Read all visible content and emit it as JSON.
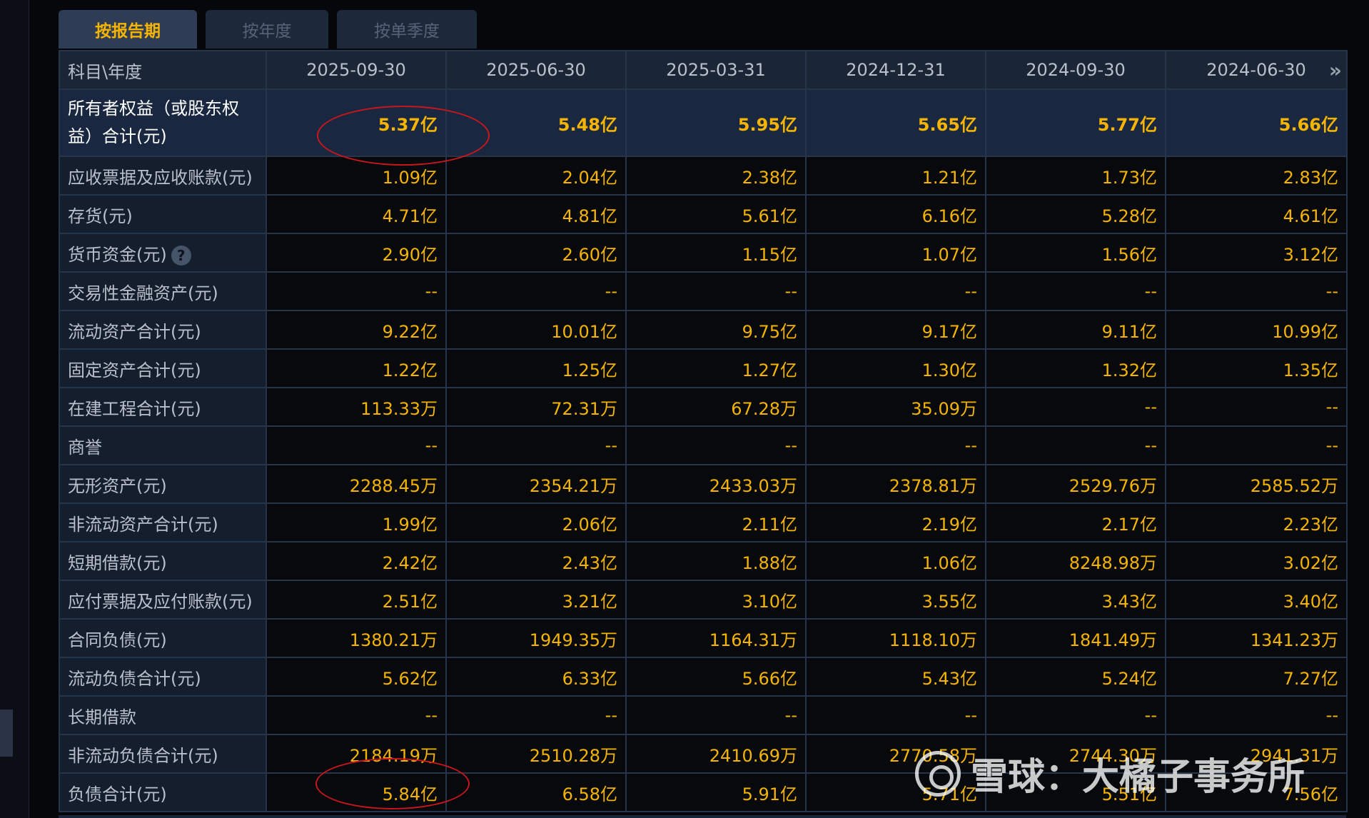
{
  "tabs": [
    {
      "label": "按报告期",
      "active": true
    },
    {
      "label": "按年度",
      "active": false
    },
    {
      "label": "按单季度",
      "active": false
    }
  ],
  "header": {
    "label": "科目\\年度",
    "periods": [
      "2025-09-30",
      "2025-06-30",
      "2025-03-31",
      "2024-12-31",
      "2024-09-30",
      "2024-06-30"
    ],
    "more_icon": "double-chevron-right-icon"
  },
  "rows": [
    {
      "label": "所有者权益（或股东权益）合计(元)",
      "values": [
        "5.37亿",
        "5.48亿",
        "5.95亿",
        "5.65亿",
        "5.77亿",
        "5.66亿"
      ]
    },
    {
      "label": "应收票据及应收账款(元)",
      "values": [
        "1.09亿",
        "2.04亿",
        "2.38亿",
        "1.21亿",
        "1.73亿",
        "2.83亿"
      ]
    },
    {
      "label": "存货(元)",
      "values": [
        "4.71亿",
        "4.81亿",
        "5.61亿",
        "6.16亿",
        "5.28亿",
        "4.61亿"
      ]
    },
    {
      "label": "货币资金(元)",
      "values": [
        "2.90亿",
        "2.60亿",
        "1.15亿",
        "1.07亿",
        "1.56亿",
        "3.12亿"
      ]
    },
    {
      "label": "交易性金融资产(元)",
      "values": [
        "--",
        "--",
        "--",
        "--",
        "--",
        "--"
      ]
    },
    {
      "label": "流动资产合计(元)",
      "values": [
        "9.22亿",
        "10.01亿",
        "9.75亿",
        "9.17亿",
        "9.11亿",
        "10.99亿"
      ]
    },
    {
      "label": "固定资产合计(元)",
      "values": [
        "1.22亿",
        "1.25亿",
        "1.27亿",
        "1.30亿",
        "1.32亿",
        "1.35亿"
      ]
    },
    {
      "label": "在建工程合计(元)",
      "values": [
        "113.33万",
        "72.31万",
        "67.28万",
        "35.09万",
        "--",
        "--"
      ]
    },
    {
      "label": "商誉",
      "values": [
        "--",
        "--",
        "--",
        "--",
        "--",
        "--"
      ]
    },
    {
      "label": "无形资产(元)",
      "values": [
        "2288.45万",
        "2354.21万",
        "2433.03万",
        "2378.81万",
        "2529.76万",
        "2585.52万"
      ]
    },
    {
      "label": "非流动资产合计(元)",
      "values": [
        "1.99亿",
        "2.06亿",
        "2.11亿",
        "2.19亿",
        "2.17亿",
        "2.23亿"
      ]
    },
    {
      "label": "短期借款(元)",
      "values": [
        "2.42亿",
        "2.43亿",
        "1.88亿",
        "1.06亿",
        "8248.98万",
        "3.02亿"
      ]
    },
    {
      "label": "应付票据及应付账款(元)",
      "values": [
        "2.51亿",
        "3.21亿",
        "3.10亿",
        "3.55亿",
        "3.43亿",
        "3.40亿"
      ]
    },
    {
      "label": "合同负债(元)",
      "values": [
        "1380.21万",
        "1949.35万",
        "1164.31万",
        "1118.10万",
        "1841.49万",
        "1341.23万"
      ]
    },
    {
      "label": "流动负债合计(元)",
      "values": [
        "5.62亿",
        "6.33亿",
        "5.66亿",
        "5.43亿",
        "5.24亿",
        "7.27亿"
      ]
    },
    {
      "label": "长期借款",
      "values": [
        "--",
        "--",
        "--",
        "--",
        "--",
        "--"
      ]
    },
    {
      "label": "非流动负债合计(元)",
      "values": [
        "2184.19万",
        "2510.28万",
        "2410.69万",
        "2770.58万",
        "2744.30万",
        "2941.31万"
      ]
    },
    {
      "label": "负债合计(元)",
      "values": [
        "5.84亿",
        "6.58亿",
        "5.91亿",
        "5.71亿",
        "5.51亿",
        "7.56亿"
      ]
    }
  ],
  "help_icon": "question-circle-icon",
  "watermark": "雪球：大橘子事务所",
  "colors": {
    "value": "#f5b400",
    "highlight_circle": "#c8171c"
  }
}
